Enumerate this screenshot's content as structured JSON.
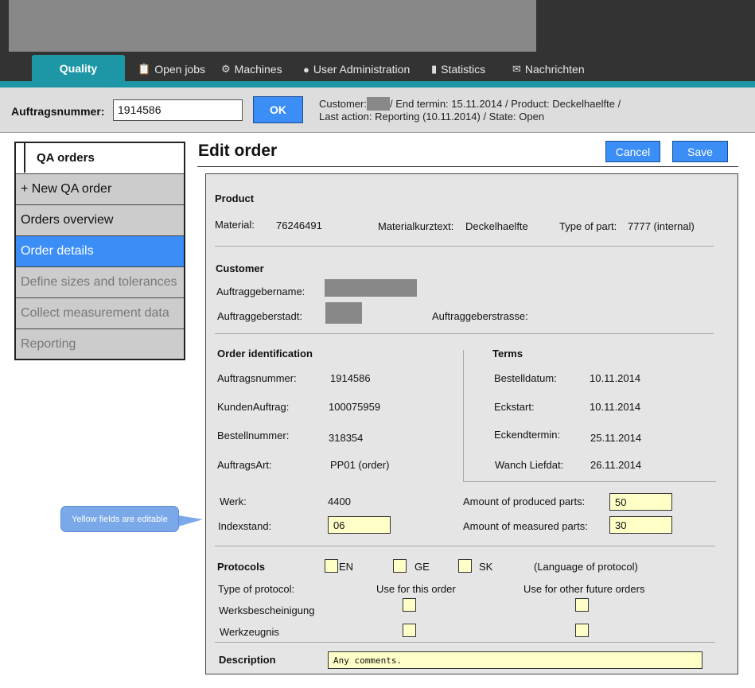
{
  "nav": {
    "tabs": [
      {
        "label": "Quality",
        "icon": ""
      },
      {
        "label": "Open jobs",
        "icon": "clipboard-icon"
      },
      {
        "label": "Machines",
        "icon": "gear-icon"
      },
      {
        "label": "User Administration",
        "icon": "users-icon"
      },
      {
        "label": "Statistics",
        "icon": "bar-chart-icon"
      },
      {
        "label": "Nachrichten",
        "icon": "envelope-icon"
      }
    ]
  },
  "orderbar": {
    "label": "Auftragsnummer:",
    "value": "1914586",
    "ok_label": "OK",
    "info_customer": "Customer:",
    "info_line1_rest": "/ End termin: 15.11.2014 / Product: Deckelhaelfte /",
    "info_line2": "Last action: Reporting  (10.11.2014)  / State: Open"
  },
  "sidebar": {
    "title": "QA orders",
    "items": [
      {
        "label": "+ New QA order",
        "state": "normal"
      },
      {
        "label": "Orders overview",
        "state": "normal"
      },
      {
        "label": "Order details",
        "state": "active"
      },
      {
        "label": "Define sizes and tolerances",
        "state": "disabled"
      },
      {
        "label": "Collect measurement data",
        "state": "disabled"
      },
      {
        "label": "Reporting",
        "state": "disabled"
      }
    ]
  },
  "main": {
    "title": "Edit order",
    "cancel_label": "Cancel",
    "save_label": "Save",
    "product": {
      "header": "Product",
      "material_label": "Material:",
      "material_value": "76246491",
      "kurztext_label": "Materialkurztext:",
      "kurztext_value": "Deckelhaelfte",
      "type_label": "Type of part:",
      "type_value": "7777 (internal)"
    },
    "customer": {
      "header": "Customer",
      "name_label": "Auftraggebername:",
      "city_label": "Auftraggeberstadt:",
      "street_label": "Auftraggeberstrasse:"
    },
    "order_identification": {
      "header": "Order identification",
      "rows": [
        {
          "label": "Auftragsnummer:",
          "value": "1914586"
        },
        {
          "label": "KundenAuftrag:",
          "value": "100075959"
        },
        {
          "label": "Bestellnummer:",
          "value": "318354"
        },
        {
          "label": "AuftragsArt:",
          "value": "PP01 (order)"
        }
      ]
    },
    "terms": {
      "header": "Terms",
      "rows": [
        {
          "label": "Bestelldatum:",
          "value": "10.11.2014"
        },
        {
          "label": "Eckstart:",
          "value": "10.11.2014"
        },
        {
          "label": "Eckendtermin:",
          "value": "25.11.2014"
        },
        {
          "label": "Wanch Liefdat:",
          "value": "26.11.2014"
        }
      ]
    },
    "werk_label": "Werk:",
    "werk_value": "4400",
    "indexstand_label": "Indexstand:",
    "indexstand_value": "06",
    "produced_label": "Amount of produced parts:",
    "produced_value": "50",
    "measured_label": "Amount of measured parts:",
    "measured_value": "30",
    "protocols": {
      "header": "Protocols",
      "lang_en": "EN",
      "lang_ge": "GE",
      "lang_sk": "SK",
      "lang_note": "(Language of protocol)",
      "type_label": "Type of protocol:",
      "col_this": "Use for this order",
      "col_future": "Use for other future orders",
      "rows": [
        "Werksbescheinigung",
        "Werkzeugnis"
      ]
    },
    "description": {
      "header": "Description",
      "value": "Any comments."
    }
  },
  "callout": {
    "text": "Yellow fields are editable"
  },
  "colors": {
    "accent_teal": "#1d97a6",
    "button_blue": "#3b8ef5",
    "editable_yellow": "#ffffc8",
    "topbar": "#333333"
  }
}
